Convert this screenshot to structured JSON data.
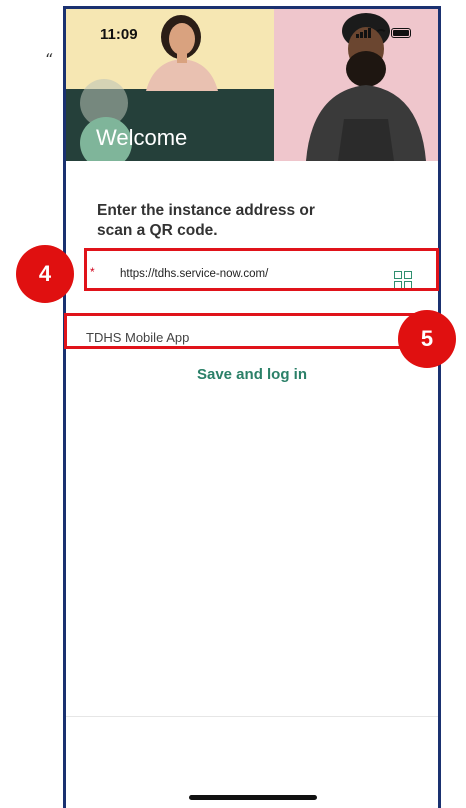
{
  "status_bar": {
    "time": "11:09"
  },
  "hero": {
    "welcome_title": "Welcome"
  },
  "form": {
    "prompt": "Enter the instance address or scan a QR code.",
    "required_mark": "*",
    "instance_url": "https://tdhs.service-now.com/",
    "instance_name": "TDHS Mobile App",
    "save_label": "Save and log in"
  },
  "annotations": {
    "quote_mark": "“",
    "badge_4": "4",
    "badge_5": "5"
  },
  "icons": {
    "qr": "qr-code-icon",
    "signal": "signal-icon",
    "wifi": "wifi-icon",
    "battery": "battery-icon"
  },
  "colors": {
    "accent_green": "#2b8068",
    "hero_dark": "#25403a",
    "callout_red": "#e0131a",
    "phone_border": "#1a3170"
  }
}
